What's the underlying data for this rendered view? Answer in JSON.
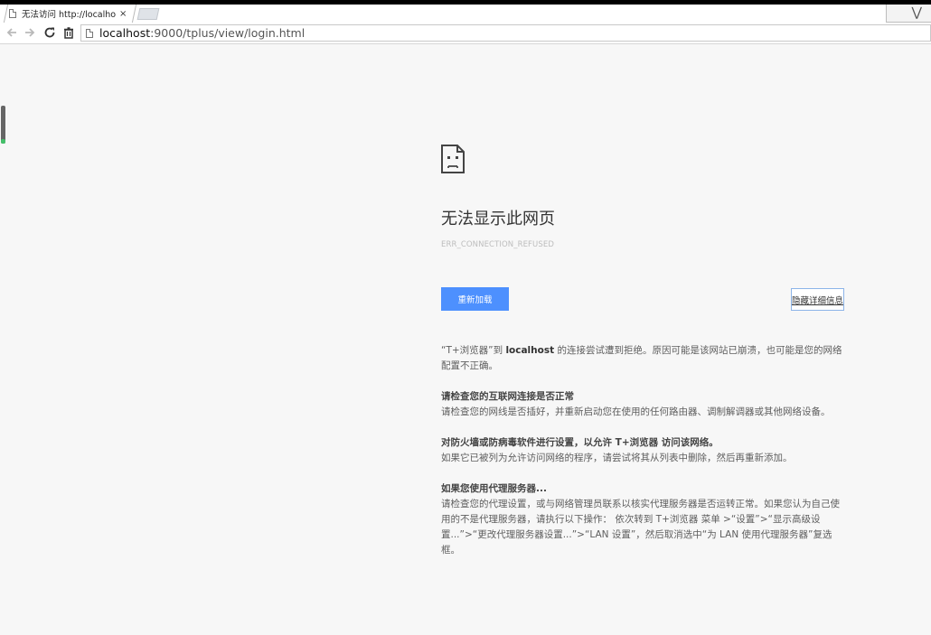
{
  "browser": {
    "tab": {
      "title": "无法访问 http://localhos",
      "close": "×"
    },
    "address": {
      "host": "localhost",
      "rest": ":9000/tplus/view/login.html"
    },
    "icons": [
      "page-icon",
      "back-icon",
      "forward-icon",
      "reload-icon",
      "trash-icon",
      "close-icon"
    ],
    "corner_glyph": "⋁"
  },
  "error_page": {
    "title": "无法显示此网页",
    "error_code": "ERR_CONNECTION_REFUSED",
    "reload_label": "重新加载",
    "details_label": "隐藏详细信息",
    "intro_pre": "“T+浏览器”到",
    "intro_host": "localhost",
    "intro_post": "的连接尝试遭到拒绝。原因可能是该网站已崩溃，也可能是您的网络配置不正确。",
    "sections": [
      {
        "heading": "请检查您的互联网连接是否正常",
        "body": "请检查您的网线是否插好，并重新启动您在使用的任何路由器、调制解调器或其他网络设备。"
      },
      {
        "heading": "对防火墙或防病毒软件进行设置，以允许 T+浏览器 访问该网络。",
        "body": "如果它已被列为允许访问网络的程序，请尝试将其从列表中删除，然后再重新添加。"
      },
      {
        "heading": "如果您使用代理服务器...",
        "body": "请检查您的代理设置，或与网络管理员联系以核实代理服务器是否运转正常。如果您认为自己使用的不是代理服务器，请执行以下操作： 依次转到 T+浏览器 菜单 >“设置”>“显示高级设置...”>“更改代理服务器设置...”>“LAN 设置”，然后取消选中“为 LAN 使用代理服务器”复选框。"
      }
    ]
  }
}
